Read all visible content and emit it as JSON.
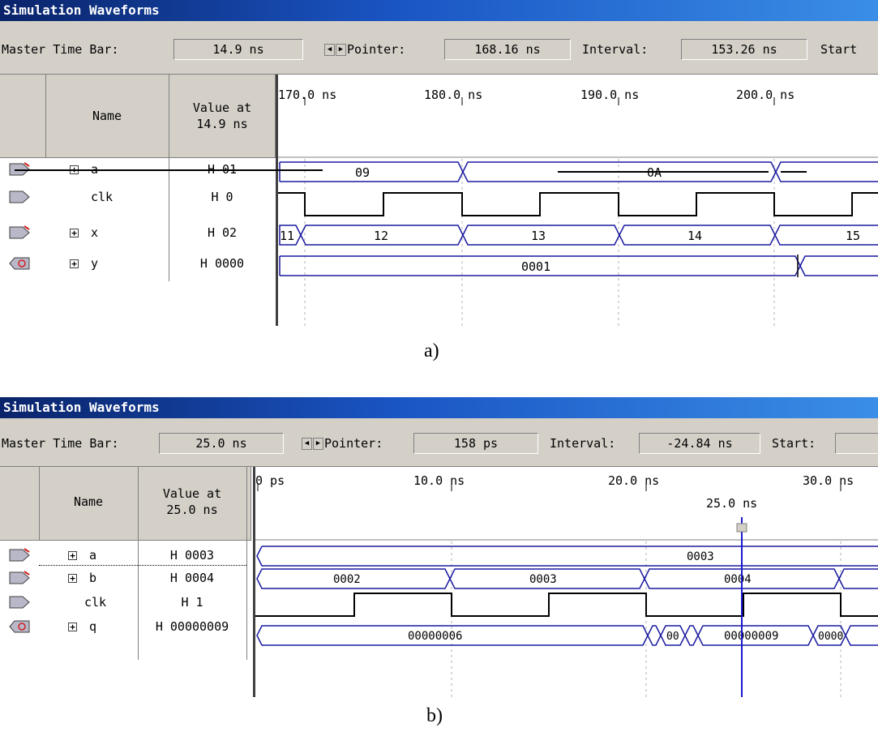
{
  "panel_a": {
    "title": "Simulation Waveforms",
    "master_time_bar_label": "Master Time Bar:",
    "master_time_bar_value": "14.9 ns",
    "pointer_label": "Pointer:",
    "pointer_value": "168.16 ns",
    "interval_label": "Interval:",
    "interval_value": "153.26 ns",
    "start_label": "Start",
    "col_name": "Name",
    "col_value_line1": "Value at",
    "col_value_line2": "14.9 ns",
    "time_ticks": [
      "170.0 ns",
      "180.0 ns",
      "190.0 ns",
      "200.0 ns"
    ],
    "signals": [
      {
        "name": "a",
        "expandable": true,
        "pin": "input",
        "value": "H 01"
      },
      {
        "name": "clk",
        "expandable": false,
        "pin": "input",
        "value": "H 0"
      },
      {
        "name": "x",
        "expandable": true,
        "pin": "input",
        "value": "H 02"
      },
      {
        "name": "y",
        "expandable": true,
        "pin": "output",
        "value": "H 0000"
      }
    ],
    "wave_labels": {
      "a": [
        "09",
        "0A"
      ],
      "x": [
        "11",
        "12",
        "13",
        "14",
        "15"
      ],
      "y": [
        "0001"
      ]
    },
    "caption": "a)"
  },
  "panel_b": {
    "title": "Simulation Waveforms",
    "master_time_bar_label": "Master Time Bar:",
    "master_time_bar_value": "25.0 ns",
    "pointer_label": "Pointer:",
    "pointer_value": "158 ps",
    "interval_label": "Interval:",
    "interval_value": "-24.84 ns",
    "start_label": "Start:",
    "col_name": "Name",
    "col_value_line1": "Value at",
    "col_value_line2": "25.0 ns",
    "time_ticks": [
      "0 ps",
      "10.0 ns",
      "20.0 ns",
      "30.0 ns"
    ],
    "cursor_label": "25.0 ns",
    "signals": [
      {
        "name": "a",
        "expandable": true,
        "pin": "input",
        "value": "H 0003"
      },
      {
        "name": "b",
        "expandable": true,
        "pin": "input",
        "value": "H 0004"
      },
      {
        "name": "clk",
        "expandable": false,
        "pin": "input",
        "value": "H 1"
      },
      {
        "name": "q",
        "expandable": true,
        "pin": "output",
        "value": "H 00000009"
      }
    ],
    "wave_labels": {
      "a": [
        "0003"
      ],
      "b": [
        "0002",
        "0003",
        "0004"
      ],
      "q": [
        "00000006",
        "00",
        "00000009",
        "0000"
      ]
    },
    "caption": "b)"
  },
  "colors": {
    "wave": "#1a1aa0",
    "cursor": "#1a1ad0",
    "titlebar": "#0a246a"
  }
}
